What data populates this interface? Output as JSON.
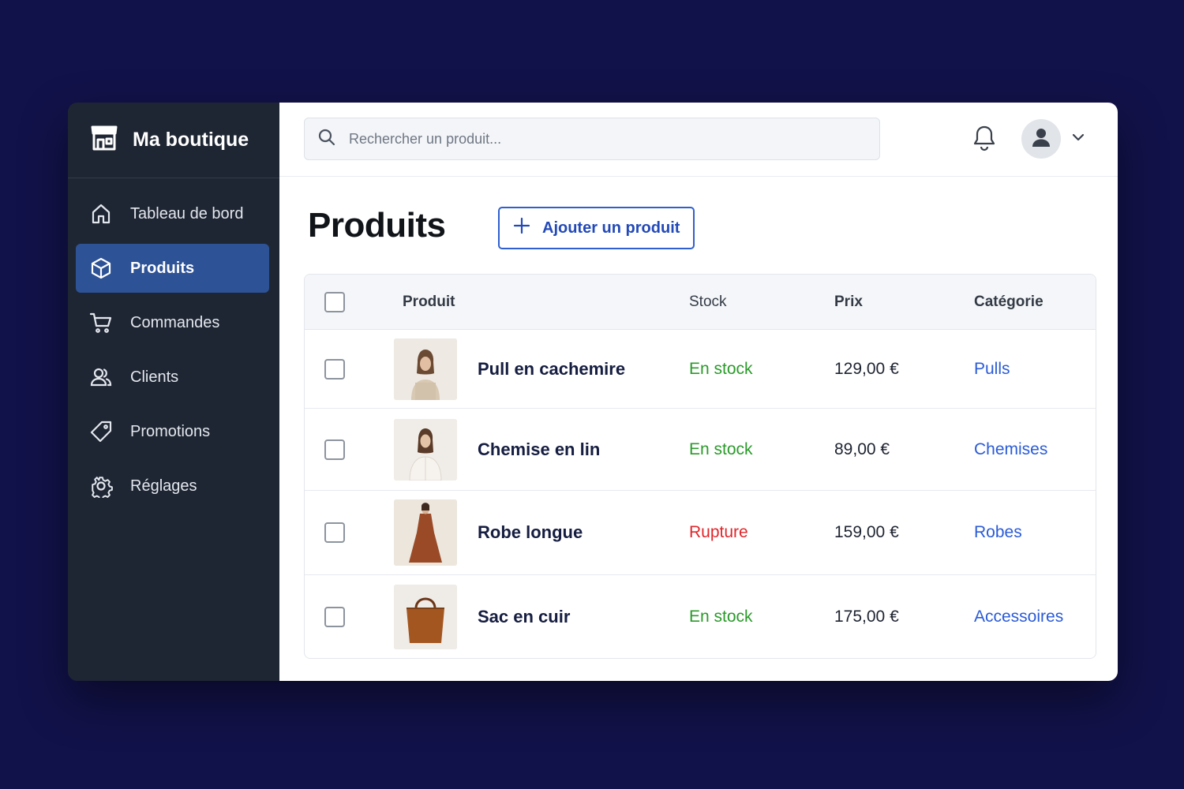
{
  "brand": {
    "name": "Ma boutique",
    "icon": "store-icon"
  },
  "sidebar": {
    "items": [
      {
        "label": "Tableau de bord",
        "icon": "home-icon",
        "active": false
      },
      {
        "label": "Produits",
        "icon": "box-icon",
        "active": true
      },
      {
        "label": "Commandes",
        "icon": "cart-icon",
        "active": false
      },
      {
        "label": "Clients",
        "icon": "users-icon",
        "active": false
      },
      {
        "label": "Promotions",
        "icon": "tag-icon",
        "active": false
      },
      {
        "label": "Réglages",
        "icon": "gear-icon",
        "active": false
      }
    ]
  },
  "search": {
    "placeholder": "Rechercher un produit..."
  },
  "header": {
    "title": "Produits",
    "add_label": "Ajouter un produit"
  },
  "table": {
    "columns": {
      "product": "Produit",
      "stock": "Stock",
      "price": "Prix",
      "category": "Catégorie"
    },
    "rows": [
      {
        "name": "Pull en cachemire",
        "stock": "En stock",
        "stock_status": "in",
        "price": "129,00 €",
        "category": "Pulls"
      },
      {
        "name": "Chemise en lin",
        "stock": "En stock",
        "stock_status": "in",
        "price": "89,00 €",
        "category": "Chemises"
      },
      {
        "name": "Robe longue",
        "stock": "Rupture",
        "stock_status": "out",
        "price": "159,00 €",
        "category": "Robes"
      },
      {
        "name": "Sac en cuir",
        "stock": "En stock",
        "stock_status": "in",
        "price": "175,00 €",
        "category": "Accessoires"
      }
    ]
  },
  "colors": {
    "background": "#12124a",
    "sidebar": "#1f2633",
    "active_nav": "#2d5296",
    "accent": "#2f5fd0",
    "in_stock": "#2a9a2a",
    "out_of_stock": "#e0262b",
    "category_link": "#2a5bd7"
  }
}
